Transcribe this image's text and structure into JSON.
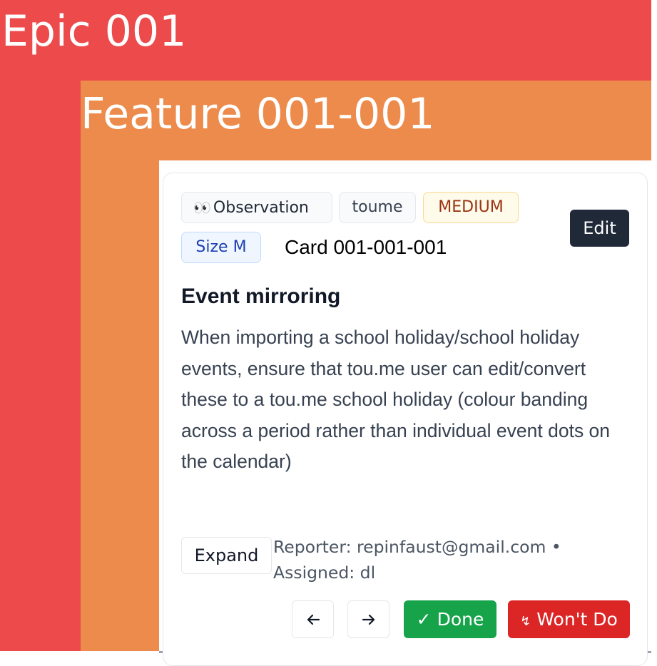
{
  "epic": {
    "title": "Epic 001"
  },
  "feature": {
    "title": "Feature 001-001"
  },
  "card": {
    "id_label": "Card 001-001-001",
    "tags": {
      "type_icon": "👀",
      "type_label": "Observation",
      "project": "toume",
      "priority": "MEDIUM",
      "size": "Size M"
    },
    "edit_label": "Edit",
    "title": "Event mirroring",
    "description": "When importing a school holiday/school holiday events, ensure that tou.me user can edit/convert these to a tou.me school holiday (colour banding across a period rather than individual event dots on the calendar)",
    "expand_label": "Expand",
    "reporter_line": "Reporter: repinfaust@gmail.com •",
    "assigned_line": "Assigned: dl",
    "actions": {
      "prev_icon": "arrow-left-icon",
      "next_icon": "arrow-right-icon",
      "done_icon": "✓",
      "done_label": "Done",
      "wont_icon": "↯",
      "wont_label": "Won't Do"
    }
  },
  "colors": {
    "epic_bg": "#ec4a4b",
    "feature_bg": "#ec8b4b",
    "done_bg": "#16a34a",
    "wont_bg": "#dc2626",
    "edit_bg": "#1f2937"
  }
}
